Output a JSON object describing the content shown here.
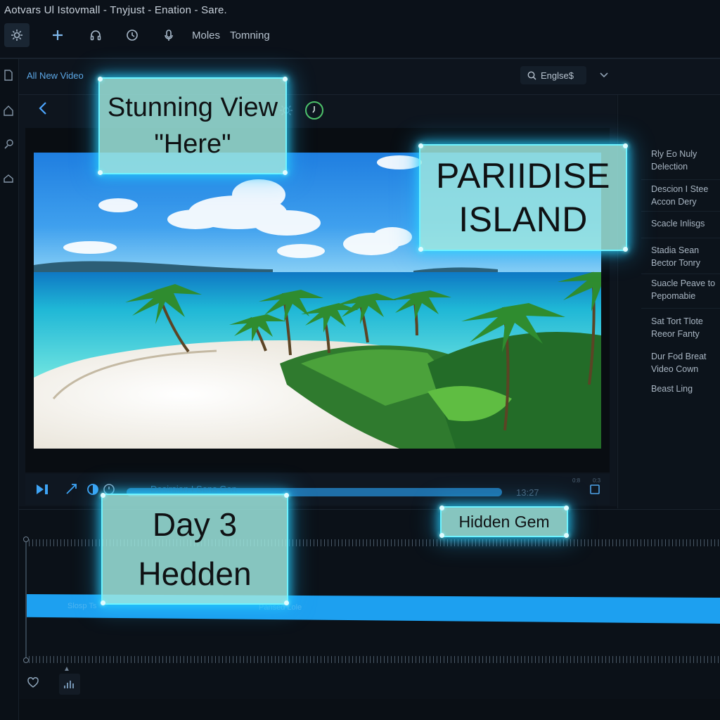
{
  "window": {
    "title": "Aotvars Ul Istovmall - Tnyjust - Enation - Sare."
  },
  "toolbar": {
    "items": [
      {
        "icon": "effects-icon"
      },
      {
        "icon": "add-icon"
      },
      {
        "icon": "headphones-icon"
      },
      {
        "icon": "timer-icon"
      },
      {
        "icon": "microphone-icon"
      }
    ],
    "menu_1": "Moles",
    "menu_2": "Tomning"
  },
  "header": {
    "project_title": "All New Video",
    "language": "Englse$"
  },
  "preview": {
    "scene": "tropical beach with turquoise water, white sand and palm trees",
    "seek_label": "Desirsion I Sens Gen",
    "timecode": "13:27",
    "tiny_a": "0:8",
    "tiny_b": "0:3"
  },
  "overlays": {
    "stunning": "Stunning View\n\"Here\"",
    "paradise": "PARIIDISE\nISLAND",
    "day3": "Day 3\nHedden",
    "gem": "Hidden Gem"
  },
  "right_panel": {
    "items": [
      "Rly Eo Nuly Delection",
      "Descion I Stee Accon Dery",
      "Scacle Inlisgs",
      "Stadia Sean Bector Tonry",
      "Suacle Peave to Pepomabie",
      "Sat Tort Tlote Reeor Fanty",
      "Dur Fod Breat Video Cown",
      "Beast Ling"
    ]
  },
  "timeline": {
    "clip_label_1": "Slosp Ts",
    "clip_label_2": "Pansed Lole"
  },
  "colors": {
    "background": "#0b1119",
    "accent": "#1da0f0",
    "glow": "#6ff3ff"
  }
}
